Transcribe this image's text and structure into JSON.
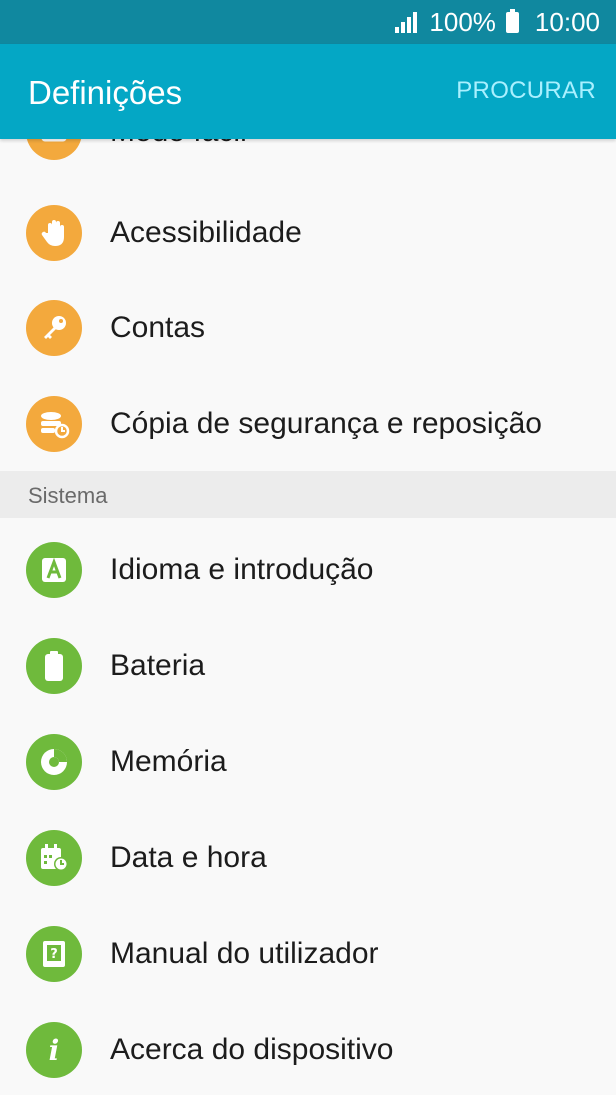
{
  "status": {
    "battery": "100%",
    "time": "10:00"
  },
  "appbar": {
    "title": "Definições",
    "search_label": "PROCURAR"
  },
  "items_top": [
    {
      "label": "Modo fácil",
      "icon": "easy-mode-icon"
    },
    {
      "label": "Acessibilidade",
      "icon": "hand-icon"
    },
    {
      "label": "Contas",
      "icon": "key-icon"
    },
    {
      "label": "Cópia de segurança e reposição",
      "icon": "backup-icon"
    }
  ],
  "section": {
    "title": "Sistema"
  },
  "items_system": [
    {
      "label": "Idioma e introdução",
      "icon": "language-icon"
    },
    {
      "label": "Bateria",
      "icon": "battery-icon"
    },
    {
      "label": "Memória",
      "icon": "storage-icon"
    },
    {
      "label": "Data e hora",
      "icon": "calendar-clock-icon"
    },
    {
      "label": "Manual do utilizador",
      "icon": "manual-icon"
    },
    {
      "label": "Acerca do dispositivo",
      "icon": "info-icon"
    }
  ],
  "colors": {
    "statusbar": "#10889f",
    "appbar": "#04a7c5",
    "orange_icon": "#f3a93d",
    "green_icon": "#6fba3c"
  }
}
